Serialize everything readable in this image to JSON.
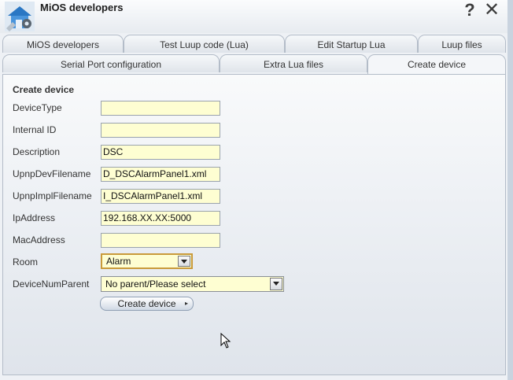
{
  "window": {
    "title": "MiOS developers"
  },
  "titlebar": {
    "help_glyph": "?",
    "close_glyph": "✕",
    "logo_icon": "house-gear-icon"
  },
  "tabs_row1": [
    {
      "label": "MiOS developers"
    },
    {
      "label": "Test Luup code (Lua)"
    },
    {
      "label": "Edit Startup Lua"
    },
    {
      "label": "Luup files"
    }
  ],
  "tabs_row2": [
    {
      "label": "Serial Port configuration"
    },
    {
      "label": "Extra Lua files"
    },
    {
      "label": "Create device",
      "active": true
    }
  ],
  "form": {
    "section_title": "Create device",
    "fields": [
      {
        "label": "DeviceType",
        "value": ""
      },
      {
        "label": "Internal ID",
        "value": ""
      },
      {
        "label": "Description",
        "value": "DSC"
      },
      {
        "label": "UpnpDevFilename",
        "value": "D_DSCAlarmPanel1.xml"
      },
      {
        "label": "UpnpImplFilename",
        "value": "I_DSCAlarmPanel1.xml"
      },
      {
        "label": "IpAddress",
        "value": "192.168.XX.XX:5000"
      },
      {
        "label": "MacAddress",
        "value": ""
      }
    ],
    "room": {
      "label": "Room",
      "selected": "Alarm"
    },
    "device_num_parent": {
      "label": "DeviceNumParent",
      "selected": "No parent/Please select"
    },
    "submit_label": "Create device",
    "submit_arrow": "▸"
  },
  "colors": {
    "input_bg": "#fefed2",
    "panel_border": "#b3bcc8",
    "room_focus": "#c99a3a"
  }
}
